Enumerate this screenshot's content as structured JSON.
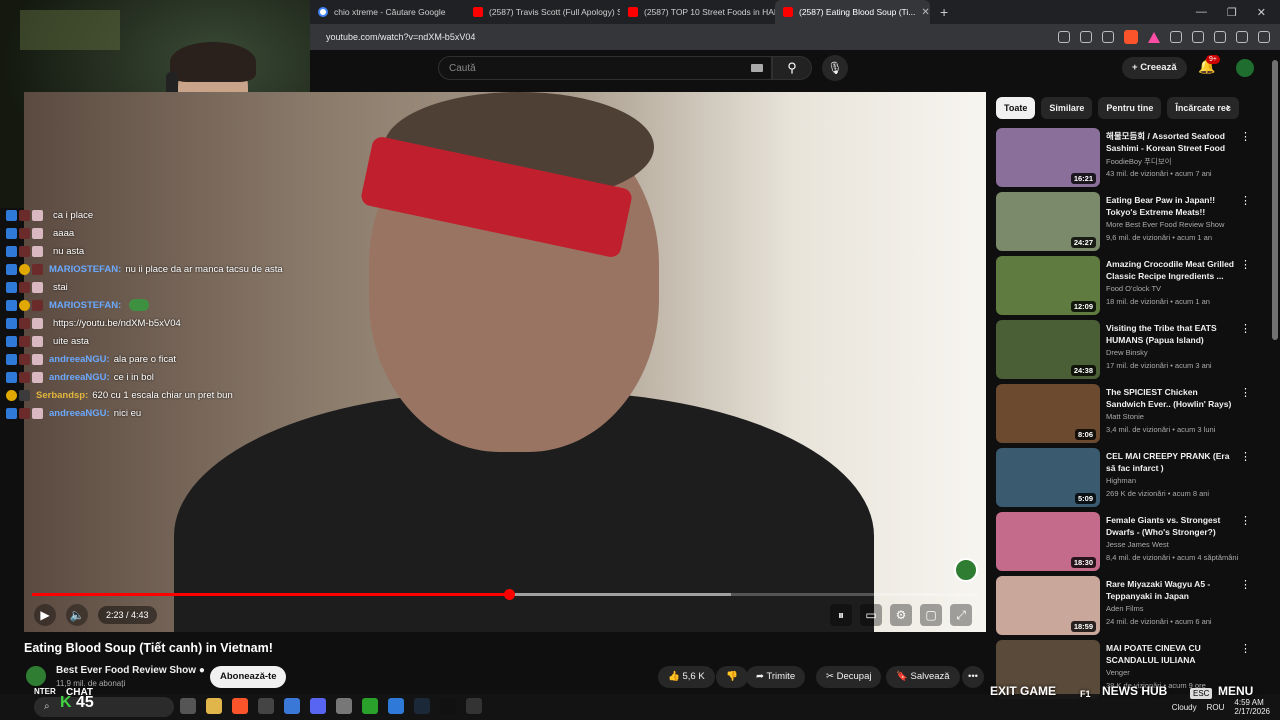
{
  "browser": {
    "tabs": [
      {
        "label": "chio xtreme - Căutare Google",
        "icon": "google-icon"
      },
      {
        "label": "(2587) Travis Scott (Full Apology) SH...",
        "icon": "youtube-icon"
      },
      {
        "label": "(2587) TOP 10 Street Foods in HANO...",
        "icon": "youtube-icon"
      },
      {
        "label": "(2587) Eating Blood Soup (Ti...",
        "icon": "youtube-icon",
        "active": true
      }
    ],
    "new_tab": "+",
    "url": "youtube.com/watch?v=ndXM-b5xV04"
  },
  "header": {
    "search_placeholder": "Caută",
    "create_label": "Creează",
    "notifications_count": "9+"
  },
  "video": {
    "time": "2:23 / 4:43",
    "progress": 0.505,
    "buffered": 0.74,
    "title": "Eating Blood Soup (Tiết canh) in Vietnam!",
    "channel": "Best Ever Food Review Show",
    "subscribers": "11,9 mil. de abonați",
    "subscribe_label": "Abonează-te",
    "likes": "5,6 K",
    "share_label": "Trimite",
    "clip_label": "Decupaj",
    "save_label": "Salvează",
    "more": "•••"
  },
  "chat": [
    {
      "user": "",
      "msg": "ca i place",
      "icons": [
        "b",
        "c",
        "p"
      ]
    },
    {
      "user": "",
      "msg": "aaaa",
      "icons": [
        "b",
        "c",
        "p"
      ]
    },
    {
      "user": "",
      "msg": "nu asta",
      "icons": [
        "b",
        "c",
        "p"
      ]
    },
    {
      "user": "MARIOSTEFAN:",
      "msg": "nu ii place da ar manca tacsu de asta",
      "icons": [
        "b",
        "y",
        "c"
      ]
    },
    {
      "user": "",
      "msg": "stai",
      "icons": [
        "b",
        "c",
        "p"
      ]
    },
    {
      "user": "MARIOSTEFAN:",
      "msg": "",
      "icons": [
        "b",
        "y",
        "c"
      ],
      "emote": true
    },
    {
      "user": "",
      "msg": "https://youtu.be/ndXM-b5xV04",
      "icons": [
        "b",
        "c",
        "p"
      ]
    },
    {
      "user": "",
      "msg": "uite asta",
      "icons": [
        "b",
        "c",
        "p"
      ]
    },
    {
      "user": "andreeaNGU:",
      "msg": "ala pare o ficat",
      "icons": [
        "b",
        "c",
        "p"
      ]
    },
    {
      "user": "andreeaNGU:",
      "msg": "ce i in bol",
      "icons": [
        "b",
        "c",
        "p"
      ]
    },
    {
      "user": "Serbandsp:",
      "msg": "620 cu 1 escala chiar un pret bun",
      "icons": [
        "y",
        "g"
      ],
      "style": "s"
    },
    {
      "user": "andreeaNGU:",
      "msg": "nici eu",
      "icons": [
        "b",
        "c",
        "p"
      ]
    }
  ],
  "chips": [
    "Toate",
    "Similare",
    "Pentru tine",
    "Încărcate rec"
  ],
  "recommendations": [
    {
      "title": "해물모듬회 / Assorted Seafood Sashimi - Korean Street Food /...",
      "channel": "FoodieBoy 푸디보이",
      "meta": "43 mil. de vizionări • acum 7 ani",
      "duration": "16:21",
      "color": "#8a6f9a"
    },
    {
      "title": "Eating Bear Paw in Japan!! Tokyo's Extreme Meats!!",
      "channel": "More Best Ever Food Review Show",
      "meta": "9,6 mil. de vizionări • acum 1 an",
      "duration": "24:27",
      "color": "#7a8a6a"
    },
    {
      "title": "Amazing Crocodile Meat Grilled Classic Recipe Ingredients ...",
      "channel": "Food O'clock TV",
      "meta": "18 mil. de vizionări • acum 1 an",
      "duration": "12:09",
      "color": "#5f7b3f"
    },
    {
      "title": "Visiting the Tribe that EATS HUMANS (Papua Island)",
      "channel": "Drew Binsky",
      "meta": "17 mil. de vizionări • acum 3 ani",
      "duration": "24:38",
      "color": "#4a5f35"
    },
    {
      "title": "The SPICIEST Chicken Sandwich Ever.. (Howlin' Rays)",
      "channel": "Matt Stonie",
      "meta": "3,4 mil. de vizionări • acum 3 luni",
      "duration": "8:06",
      "color": "#6b4a2f"
    },
    {
      "title": "CEL MAI CREEPY PRANK (Era să fac infarct )",
      "channel": "Highman",
      "meta": "269 K de vizionări • acum 8 ani",
      "duration": "5:09",
      "color": "#3a5a6f"
    },
    {
      "title": "Female Giants vs. Strongest Dwarfs - (Who's Stronger?)",
      "channel": "Jesse James West",
      "meta": "8,4 mil. de vizionări • acum 4 săptămâni",
      "duration": "18:30",
      "color": "#c46a8a"
    },
    {
      "title": "Rare Miyazaki Wagyu A5 - Teppanyaki in Japan",
      "channel": "Aden Films",
      "meta": "24 mil. de vizionări • acum 6 ani",
      "duration": "18:59",
      "color": "#c9a79a"
    },
    {
      "title": "MAI POATE CINEVA CU SCANDALUL IULIANA BEREG...",
      "channel": "Venger",
      "meta": "38 K de vizionări • acum 9 ore",
      "duration": "",
      "color": "#5a4a3a"
    }
  ],
  "overlays": {
    "exit_game": "EXIT GAME",
    "news_hub": "NEWS HUB",
    "menu": "MENU",
    "esc": "ESC",
    "f1": "F1",
    "chat": "CHAT",
    "nter": "NTER",
    "k_value": "45"
  },
  "taskbar": {
    "weather": "Cloudy",
    "lang": "ROU",
    "time": "4:59 AM",
    "date": "2/17/2026"
  }
}
